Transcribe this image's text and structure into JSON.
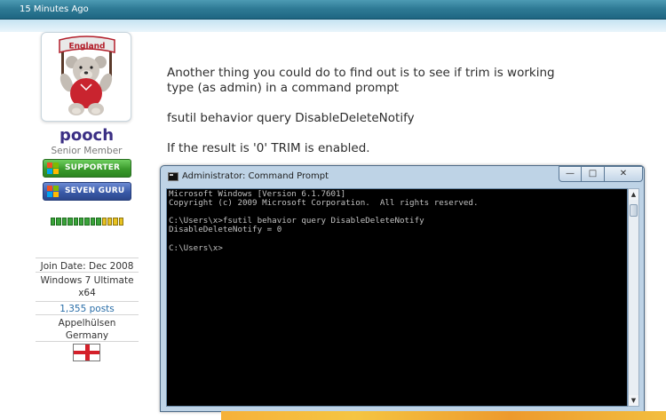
{
  "header": {
    "timestamp": "15 Minutes Ago"
  },
  "user": {
    "avatar": {
      "icon": "teddy-bear-avatar",
      "banner_text": "England"
    },
    "name": "pooch",
    "title": "Senior Member",
    "badges": [
      {
        "label": "SUPPORTER",
        "color": "#3a9a2c"
      },
      {
        "label": "SEVEN GURU",
        "color": "#3a5aa8"
      }
    ],
    "reputation": {
      "green_segments": 9,
      "yellow_segments": 4
    },
    "join_date": "Join Date: Dec 2008",
    "os": "Windows 7 Ultimate x64",
    "posts": "1,355 posts",
    "location": "Appelhülsen Germany",
    "flag_icon": "england-flag-icon"
  },
  "post": {
    "line1": "Another thing you could do to find out is to see if trim is working",
    "line2": "type (as admin) in a command prompt",
    "command": "fsutil behavior query DisableDeleteNotify",
    "result": "If the result is '0' TRIM is enabled."
  },
  "cmd_window": {
    "title": "Administrator: Command Prompt",
    "output": "Microsoft Windows [Version 6.1.7601]\nCopyright (c) 2009 Microsoft Corporation.  All rights reserved.\n\nC:\\Users\\x>fsutil behavior query DisableDeleteNotify\nDisableDeleteNotify = 0\n\nC:\\Users\\x>"
  },
  "colors": {
    "header": "#2f7b96",
    "username": "#3b2f84",
    "posts_link": "#2a6ea8",
    "console_bg": "#000000",
    "console_text": "#c0c0c0"
  }
}
